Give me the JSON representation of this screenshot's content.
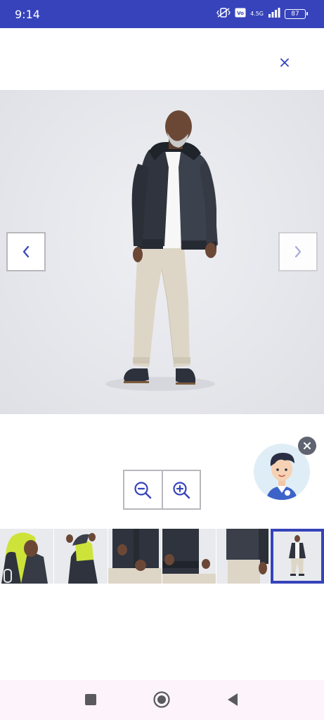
{
  "status_bar": {
    "time": "9:14",
    "network_label": "4.5G",
    "battery_level": "87",
    "background_color": "#3643ba",
    "icons": [
      "vibrate-off-icon",
      "volte-icon",
      "signal-icon",
      "battery-icon"
    ]
  },
  "viewer": {
    "close_icon": "close-icon",
    "prev_icon": "chevron-left-icon",
    "next_icon": "chevron-right-icon",
    "zoom_out_icon": "zoom-out-icon",
    "zoom_in_icon": "zoom-in-icon",
    "accent_color": "#3643ba"
  },
  "assistant": {
    "avatar_icon": "assistant-avatar-icon",
    "dismiss_icon": "close-icon"
  },
  "thumbnails": {
    "count": 6,
    "selected_index": 5
  },
  "nav_bar": {
    "icons": [
      "recents-icon",
      "home-icon",
      "back-icon"
    ]
  }
}
